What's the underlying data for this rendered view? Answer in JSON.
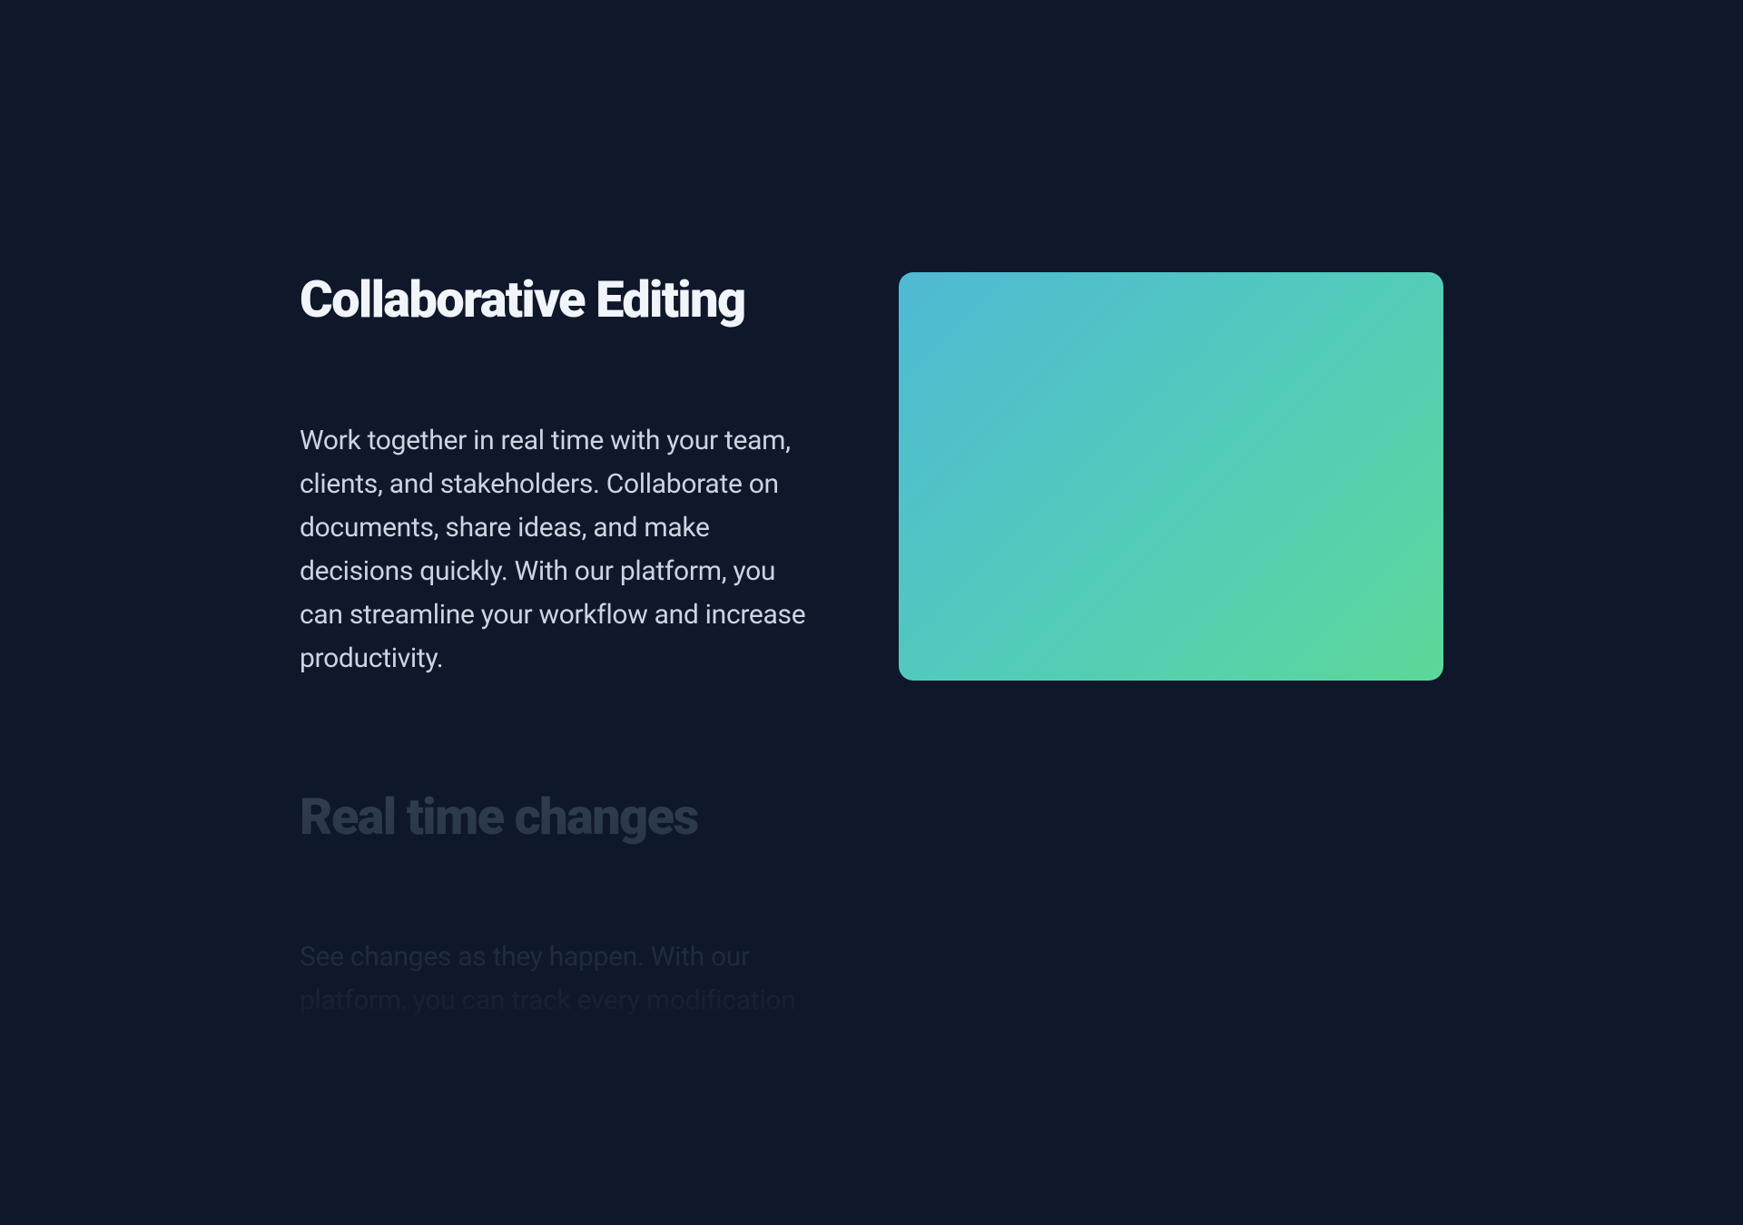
{
  "sections": [
    {
      "title": "Collaborative Editing",
      "description": "Work together in real time with your team, clients, and stakeholders. Collaborate on documents, share ideas, and make decisions quickly. With our platform, you can streamline your workflow and increase productivity.",
      "active": true
    },
    {
      "title": "Real time changes",
      "description": "See changes as they happen. With our platform, you can track every modification in",
      "active": false
    }
  ],
  "colors": {
    "background": "#0f172a",
    "titleActive": "#f1f5f9",
    "titleInactive": "#334155",
    "descriptionActive": "#cbd5e1",
    "descriptionInactive": "#475569",
    "gradientStart": "#4fb9d4",
    "gradientMid": "#52cbbb",
    "gradientEnd": "#5cd899"
  }
}
